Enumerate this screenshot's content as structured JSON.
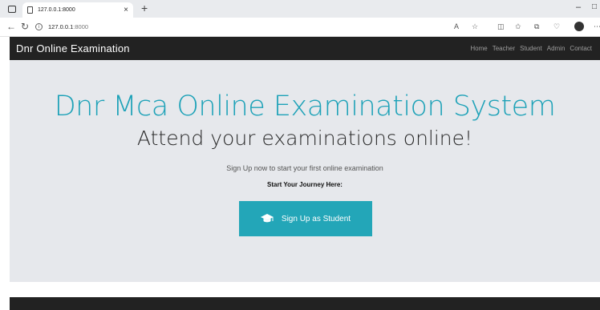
{
  "browser": {
    "tab_title": "127.0.0.1:8000",
    "tab_close": "×",
    "new_tab": "+",
    "address_host": "127.0.0.1",
    "address_port": ":8000",
    "minimize": "–",
    "maximize": "□"
  },
  "navbar": {
    "brand": "Dnr Online Examination",
    "links": [
      "Home",
      "Teacher",
      "Student",
      "Admin",
      "Contact"
    ]
  },
  "hero": {
    "title": "Dnr Mca Online Examination System",
    "subtitle": "Attend your examinations online!",
    "tagline": "Sign Up now to start your first online examination",
    "prompt": "Start Your Journey Here:",
    "button_label": "Sign Up as Student",
    "button_icon": "graduation-cap-icon"
  },
  "colors": {
    "accent": "#23a6b8",
    "navbar": "#222222",
    "jumbotron": "#e6e8ec"
  }
}
